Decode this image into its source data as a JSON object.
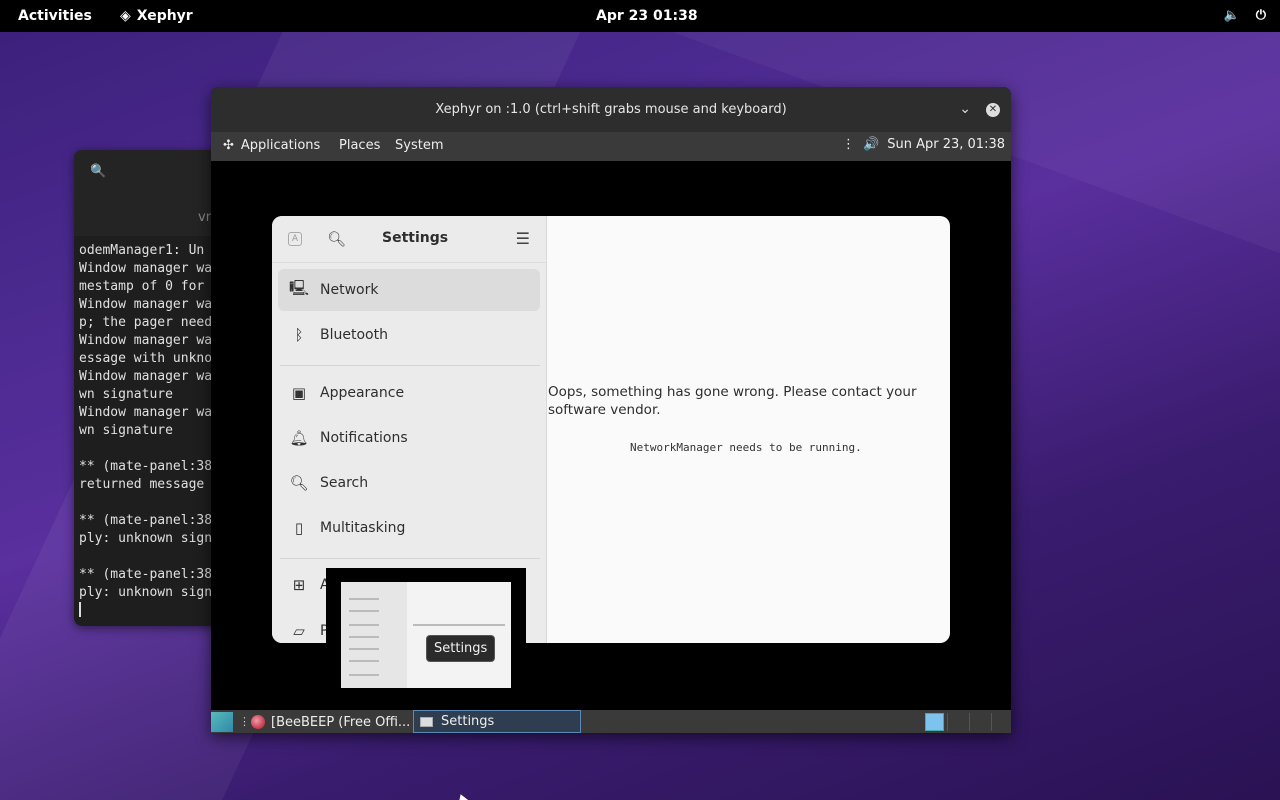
{
  "topbar": {
    "activities": "Activities",
    "app_name": "Xephyr",
    "clock": "Apr 23  01:38",
    "volume_icon": "volume-icon",
    "power_icon": "power-icon"
  },
  "terminal": {
    "title_partial": "vn",
    "lines": [
      "odemManager1: Un",
      "Window manager wa",
      "mestamp of 0 for",
      "Window manager wa",
      "p; the pager need",
      "Window manager wa",
      "essage with unkno",
      "Window manager wa",
      "wn signature",
      "Window manager wa",
      "wn signature",
      "",
      "** (mate-panel:38",
      "returned message",
      "",
      "** (mate-panel:38",
      "ply: unknown sign",
      "",
      "** (mate-panel:38",
      "ply: unknown sign"
    ]
  },
  "xephyr": {
    "title": "Xephyr on :1.0 (ctrl+shift grabs mouse and keyboard)",
    "panel": {
      "applications": "Applications",
      "places": "Places",
      "system": "System",
      "clock": "Sun Apr 23, 01:38"
    },
    "settings": {
      "title": "Settings",
      "items": [
        {
          "label": "Network",
          "icon": "network-icon"
        },
        {
          "label": "Bluetooth",
          "icon": "bluetooth-icon"
        },
        {
          "label": "Appearance",
          "icon": "appearance-icon"
        },
        {
          "label": "Notifications",
          "icon": "bell-icon"
        },
        {
          "label": "Search",
          "icon": "search-icon"
        },
        {
          "label": "Multitasking",
          "icon": "multitasking-icon"
        },
        {
          "label": "A",
          "icon": "apps-icon"
        },
        {
          "label": "P",
          "icon": "privacy-icon"
        }
      ],
      "error_message": "Oops, something has gone wrong. Please contact your software vendor.",
      "error_detail": "NetworkManager needs to be running."
    },
    "tooltip": "Settings",
    "taskbar": {
      "task1": "[BeeBEEP (Free Offi...",
      "task2": "Settings"
    }
  }
}
